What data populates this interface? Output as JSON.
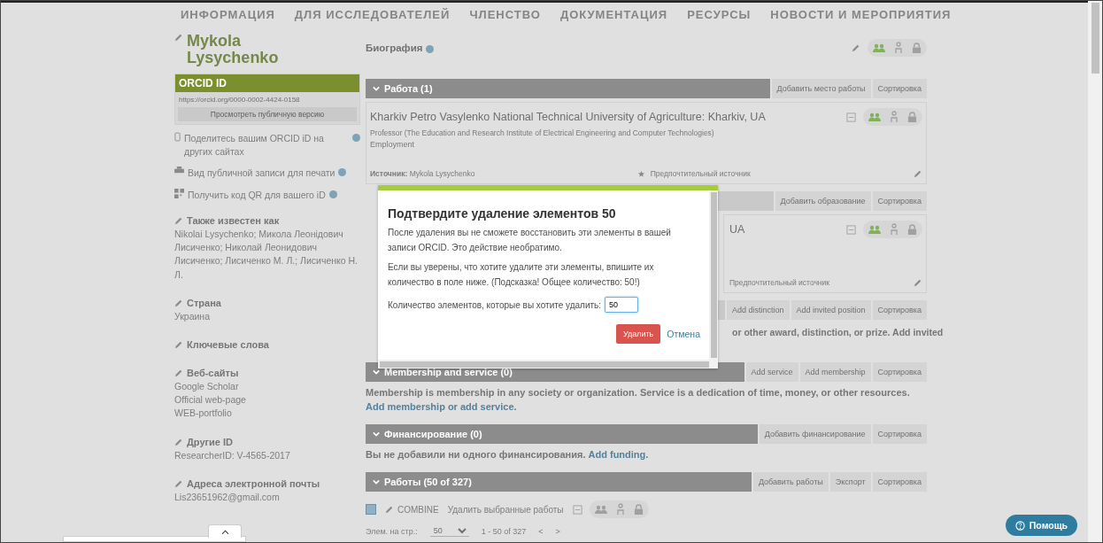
{
  "nav": {
    "items": [
      "ИНФОРМАЦИЯ",
      "ДЛЯ ИССЛЕДОВАТЕЛЕЙ",
      "ЧЛЕНСТВО",
      "ДОКУМЕНТАЦИЯ",
      "РЕСУРСЫ",
      "НОВОСТИ И МЕРОПРИЯТИЯ"
    ]
  },
  "sidebar": {
    "name": "Mykola Lysychenko",
    "orcid": {
      "title": "ORCID ID",
      "url": "https://orcid.org/0000-0002-4424-0158",
      "button": "Просмотреть публичную версию"
    },
    "links": [
      {
        "kind": "share",
        "text": "Поделитесь вашим ORCID iD на других сайтах"
      },
      {
        "kind": "print",
        "text": "Вид публичной записи для печати"
      },
      {
        "kind": "qr",
        "text": "Получить код QR для вашего iD"
      }
    ],
    "fields": [
      {
        "label": "Также известен как",
        "values": [
          "Nikolai Lysychenko; Микола Леонідович Лисиченко; Николай Леонидович Лисиченко; Лисиченко М. Л.; Лисиченко Н. Л."
        ]
      },
      {
        "label": "Страна",
        "values": [
          "Украина"
        ]
      },
      {
        "label": "Ключевые слова"
      },
      {
        "label": "Веб-сайты",
        "values": [
          "Google Scholar",
          "Official web-page",
          "WEB-portfolio"
        ]
      },
      {
        "label": "Другие ID",
        "values": [
          "ResearcherID: V-4565-2017"
        ]
      },
      {
        "label": "Адреса электронной почты",
        "values": [
          "Lis23651962@gmail.com"
        ]
      }
    ]
  },
  "biography": {
    "title": "Биография",
    "public": true
  },
  "sections": [
    {
      "title": "Работа (1)",
      "actions": [
        "Добавить место работы",
        "Сортировка"
      ],
      "items": [
        {
          "kind": "full",
          "title": "Kharkiv Petro Vasylenko National Technical University of Agriculture: Kharkiv, UA",
          "subtitle": "Professor (The Education and Research Institute of Electrical Engineering and Computer Technologies)",
          "type": "Employment",
          "source_label": "Источник:",
          "source": "Mykola Lysychenko",
          "preferred": "Предпочтительный источник",
          "public": true
        }
      ]
    },
    {
      "actions": [
        "Добавить образование",
        "Сортировка"
      ],
      "items": [
        {
          "kind": "partial",
          "title": "UA",
          "preferred": "Предпочтительный источник",
          "public": true
        }
      ]
    },
    {
      "actions": [
        "Add distinction",
        "Add invited position",
        "Сортировка"
      ],
      "note": {
        "kind": "partial",
        "text": "or other award, distinction, or prize. Add invited"
      }
    },
    {
      "title": "Membership and service (0)",
      "actions": [
        "Add service",
        "Add membership",
        "Сортировка"
      ],
      "note": {
        "kind": "full",
        "text": "Membership is membership in any society or organization. Service is a dedication of time, money, or other resources. ",
        "link": "Add membership or add service."
      }
    },
    {
      "title": "Финансирование (0)",
      "actions": [
        "Добавить финансирование",
        "Сортировка"
      ],
      "note": {
        "kind": "full",
        "text": "Вы не добавили ни одного финансирования. ",
        "link": "Add funding."
      }
    },
    {
      "title": "Работы (50 of 327)",
      "actions": [
        "Добавить работы",
        "Экспорт",
        "Сортировка"
      ]
    }
  ],
  "works_toolbar": {
    "checked": true,
    "combine": "COMBINE",
    "delete": "Удалить выбранные работы",
    "page_size_label": "Элем. на стр.:",
    "page_size": "50",
    "range": "1 - 50 of 327",
    "prev": "<",
    "next": ">"
  },
  "modal": {
    "title": "Подтвердите удаление элементов 50",
    "paragraphs": [
      "После удаления вы не сможете восстановить эти элементы в вашей записи ORCID. Это действие необратимо.",
      "Если вы уверены, что хотите удалите эти элементы, впишите их количество в поле ниже. (Подсказка! Общее количество: 50!)"
    ],
    "field_label": "Количество элементов, которые вы хотите удалить:",
    "field_value": "50",
    "delete": "Удалить",
    "cancel": "Отмена"
  },
  "help": {
    "label": "Помощь"
  }
}
